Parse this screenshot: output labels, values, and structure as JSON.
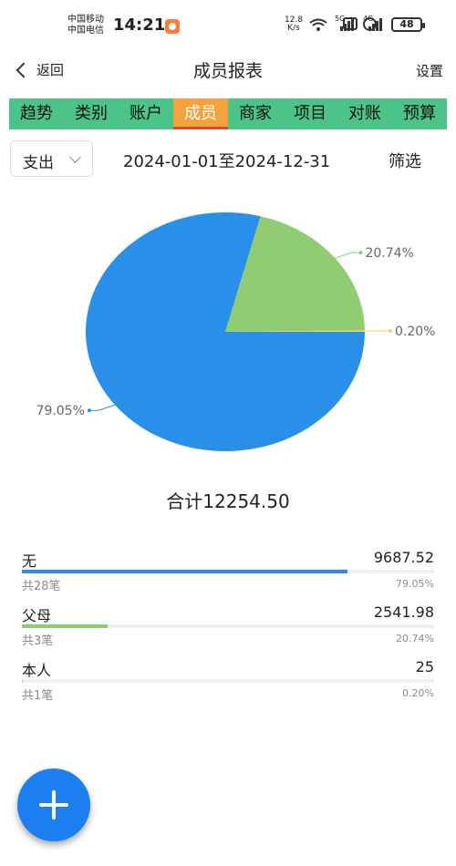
{
  "status_bar": {
    "carrier1": "中国移动",
    "carrier2": "中国电信",
    "time": "14:21",
    "net_speed_value": "12.8",
    "net_speed_unit": "K/s",
    "sig1_label": "5G",
    "sig2_label": "4G",
    "battery": "48"
  },
  "header": {
    "back_label": "返回",
    "title": "成员报表",
    "settings_label": "设置"
  },
  "tabs": [
    {
      "label": "趋势",
      "active": false
    },
    {
      "label": "类别",
      "active": false
    },
    {
      "label": "账户",
      "active": false
    },
    {
      "label": "成员",
      "active": true
    },
    {
      "label": "商家",
      "active": false
    },
    {
      "label": "项目",
      "active": false
    },
    {
      "label": "对账",
      "active": false
    },
    {
      "label": "预算",
      "active": false
    }
  ],
  "filters": {
    "type_value": "支出",
    "date_range": "2024-01-01至2024-12-31",
    "filter_label": "筛选"
  },
  "chart_data": {
    "type": "pie",
    "slices": [
      {
        "name": "无",
        "value": 9687.52,
        "percent": 79.05,
        "label": "79.05%",
        "color": "#2a8fe8"
      },
      {
        "name": "父母",
        "value": 2541.98,
        "percent": 20.74,
        "label": "20.74%",
        "color": "#8fcc72"
      },
      {
        "name": "本人",
        "value": 25,
        "percent": 0.2,
        "label": "0.20%",
        "color": "#f2d36a"
      }
    ]
  },
  "total_label": "合计12254.50",
  "members": [
    {
      "name": "无",
      "amount": "9687.52",
      "count": "共28笔",
      "percent_label": "79.05%",
      "fraction": 0.7905,
      "color": "#2a8fe8"
    },
    {
      "name": "父母",
      "amount": "2541.98",
      "count": "共3笔",
      "percent_label": "20.74%",
      "fraction": 0.2074,
      "color": "#8fcc72"
    },
    {
      "name": "本人",
      "amount": "25",
      "count": "共1笔",
      "percent_label": "0.20%",
      "fraction": 0.002,
      "color": "#f2d36a"
    }
  ]
}
